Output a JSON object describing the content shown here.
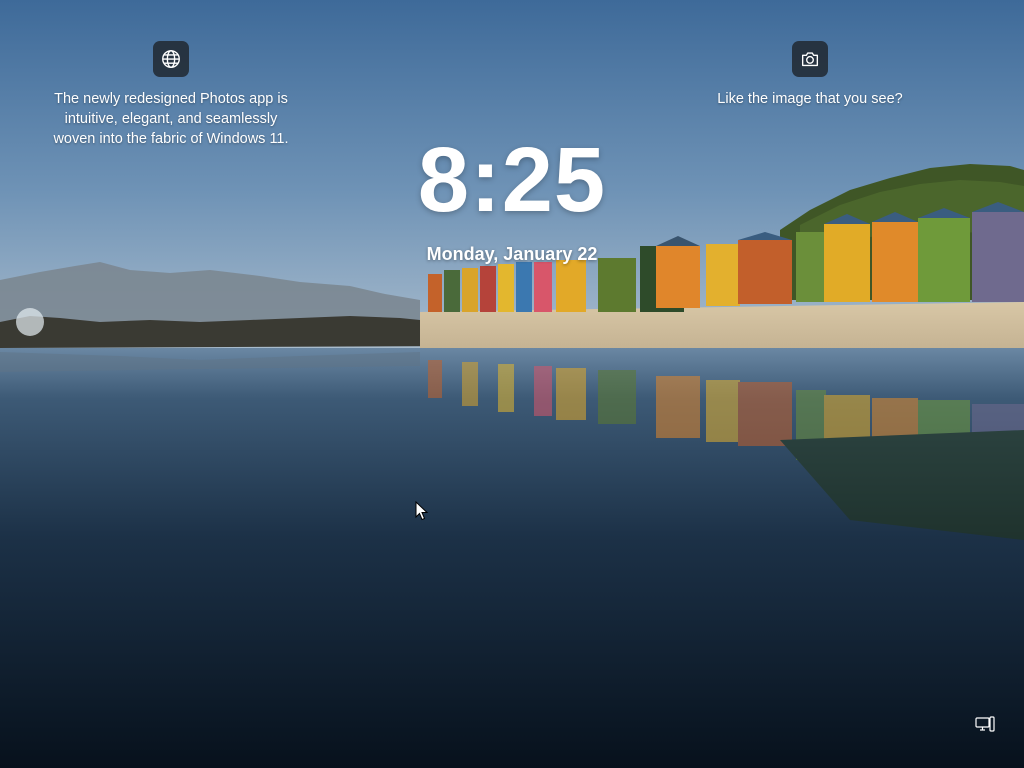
{
  "lockscreen": {
    "left_card": {
      "icon": "globe-icon",
      "text_lines": [
        "The newly redesigned Photos app is",
        "intuitive, elegant, and seamlessly",
        "woven into the fabric of Windows 11."
      ]
    },
    "right_card": {
      "icon": "camera-icon",
      "text": "Like the image that you see?"
    },
    "clock": {
      "time": "8:25",
      "date": "Monday, January 22"
    },
    "tray": {
      "icon": "network-icon"
    }
  },
  "colors": {
    "icon_tile_bg": "#1e242c",
    "text": "#ffffff"
  }
}
